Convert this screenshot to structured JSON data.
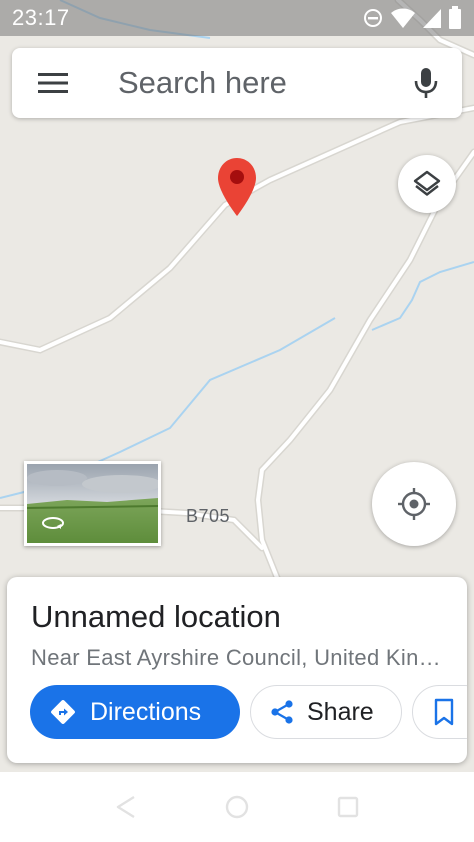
{
  "status_bar": {
    "time": "23:17",
    "icons": [
      "do-not-disturb-icon",
      "wifi-icon",
      "cell-signal-icon",
      "battery-icon"
    ]
  },
  "search": {
    "placeholder": "Search here",
    "menu_icon": "hamburger-menu-icon",
    "mic_icon": "microphone-icon"
  },
  "map": {
    "road_label": "B705",
    "pin_color": "#ea4335",
    "water_color": "#aad3f0",
    "road_color": "#ffffff",
    "land_color": "#ebe9e4"
  },
  "map_controls": {
    "layers_icon": "layers-icon",
    "location_icon": "my-location-icon",
    "streetview_icon": "360-rotate-icon"
  },
  "place": {
    "title": "Unnamed location",
    "subtitle": "Near East Ayrshire Council, United Kingdom",
    "actions": {
      "directions_label": "Directions",
      "share_label": "Share",
      "save_icon": "bookmark-icon"
    },
    "accent_color": "#1a73e8"
  },
  "nav_bar": {
    "buttons": [
      "back-icon",
      "home-icon",
      "recents-icon"
    ]
  }
}
